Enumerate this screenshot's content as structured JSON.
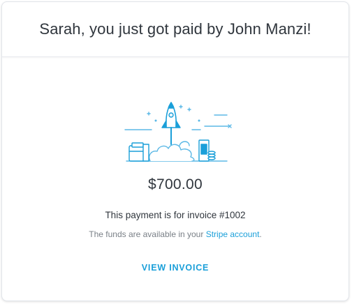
{
  "header": {
    "title": "Sarah, you just got paid by John Manzi!"
  },
  "illustration": {
    "icon": "rocket-launch-illustration",
    "accent_color": "#1a9fd9",
    "line_color": "#5bb8e6"
  },
  "payment": {
    "amount": "$700.00",
    "invoice_text": "This payment is for invoice #1002",
    "funds_prefix": "The funds are available in your ",
    "funds_link": "Stripe account",
    "funds_suffix": "."
  },
  "actions": {
    "view_invoice_label": "VIEW INVOICE"
  }
}
